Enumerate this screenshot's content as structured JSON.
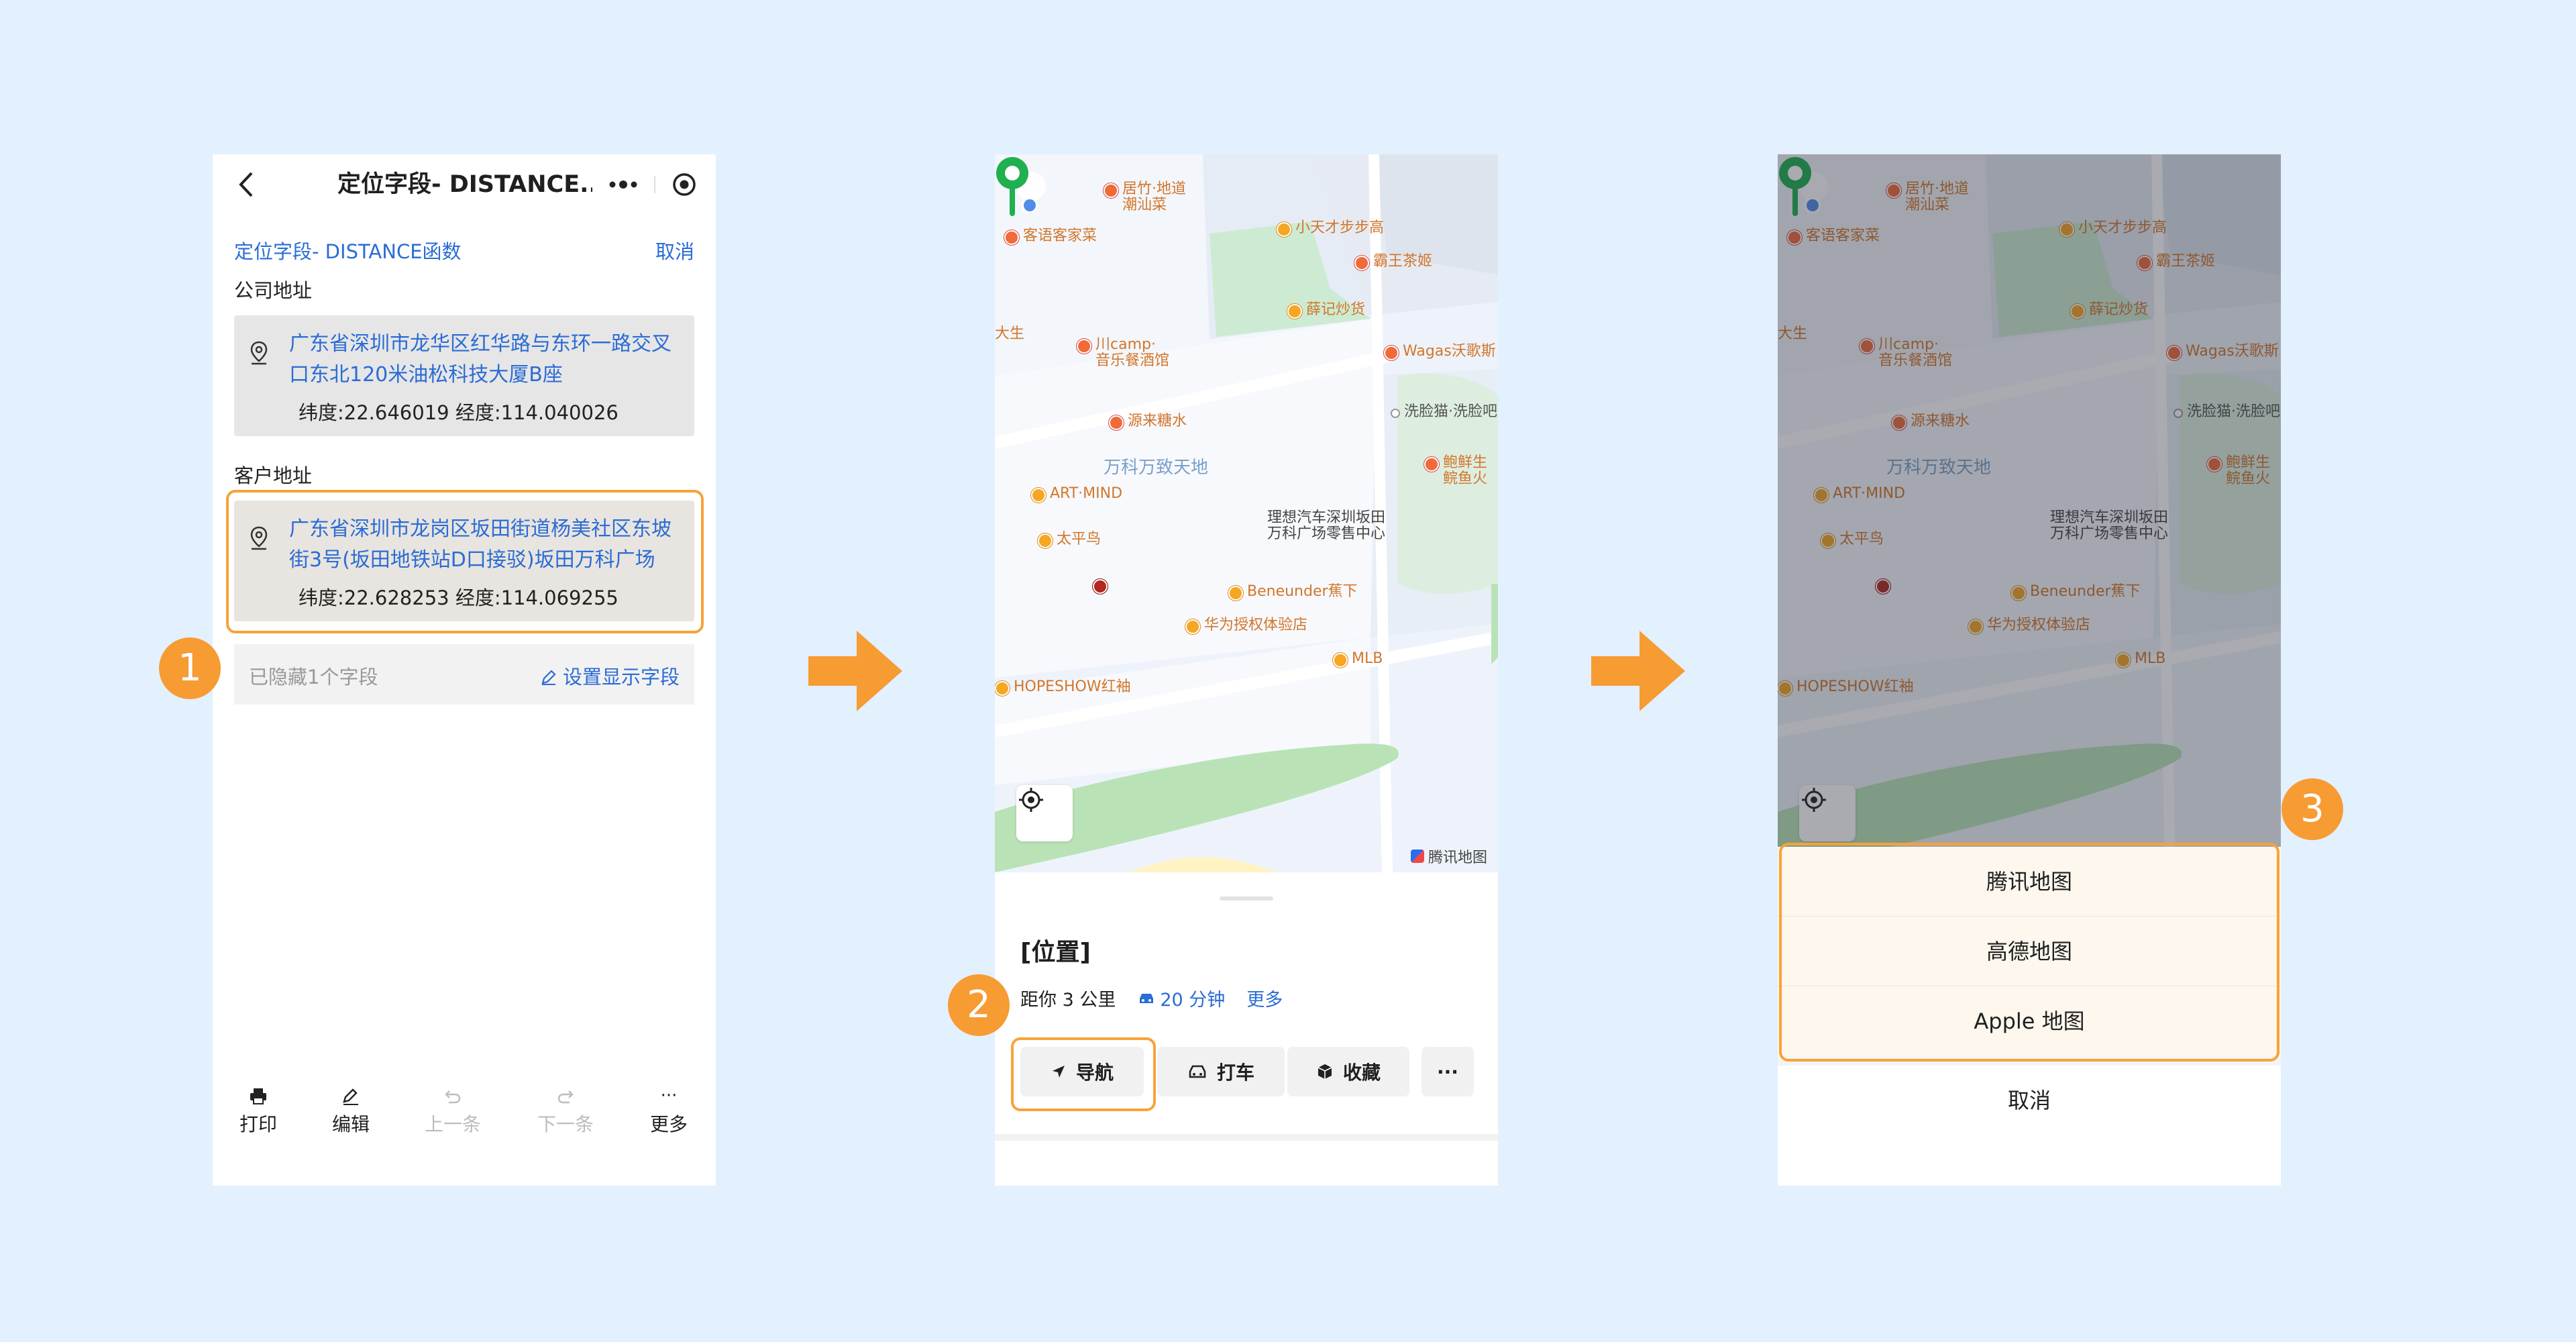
{
  "screen1": {
    "nav_title": "定位字段- DISTANCE...",
    "form_title": "定位字段- DISTANCE函数",
    "cancel": "取消",
    "company_label": "公司地址",
    "company_address": "广东省深圳市龙华区红华路与东环一路交叉口东北120米油松科技大厦B座",
    "company_coords": "纬度:22.646019 经度:114.040026",
    "customer_label": "客户地址",
    "customer_address": "广东省深圳市龙岗区坂田街道杨美社区东坡街3号(坂田地铁站D口接驳)坂田万科广场",
    "customer_coords": "纬度:22.628253 经度:114.069255",
    "hidden_hint": "已隐藏1个字段",
    "set_fields": "设置显示字段",
    "bottom": {
      "print": "打印",
      "edit": "编辑",
      "prev": "上一条",
      "next": "下一条",
      "more": "更多"
    }
  },
  "map": {
    "pois": {
      "juzhu": "居竹·地道\n潮汕菜",
      "kexiang": "客语客家菜",
      "xiaotiancai": "小天才步步高",
      "bawang": "霸王茶姬",
      "xueji": "薛记炒货",
      "dasheng": "大生",
      "camp": "川camp·\n音乐餐酒馆",
      "wagas": "Wagas沃歌斯",
      "xilianmao": "洗脸猫·洗脸吧",
      "yuanlai": "源来糖水",
      "vanke": "万科万致天地",
      "artmind": "ART·MIND",
      "baoxian": "鲍鲜生\n鲩鱼火",
      "taipingniao": "太平鸟",
      "lixiang": "理想汽车深圳坂田\n万科广场零售中心",
      "beneunder": "Beneunder蕉下",
      "huawei": "华为授权体验店",
      "mlb": "MLB",
      "hopeshow": "HOPESHOW红袖",
      "tencent_map": "腾讯地图"
    }
  },
  "screen2": {
    "place_title": "[位置]",
    "distance": "距你 3 公里",
    "drive_time": "20 分钟",
    "more": "更多",
    "navigate": "导航",
    "taxi": "打车",
    "favorite": "收藏",
    "overflow": "···"
  },
  "screen3": {
    "options": [
      "腾讯地图",
      "高德地图",
      "Apple 地图"
    ],
    "cancel": "取消"
  },
  "badges": {
    "one": "1",
    "two": "2",
    "three": "3"
  },
  "colors": {
    "accent": "#f79b33",
    "link": "#2b6cd5",
    "background": "#e3f0fd"
  }
}
